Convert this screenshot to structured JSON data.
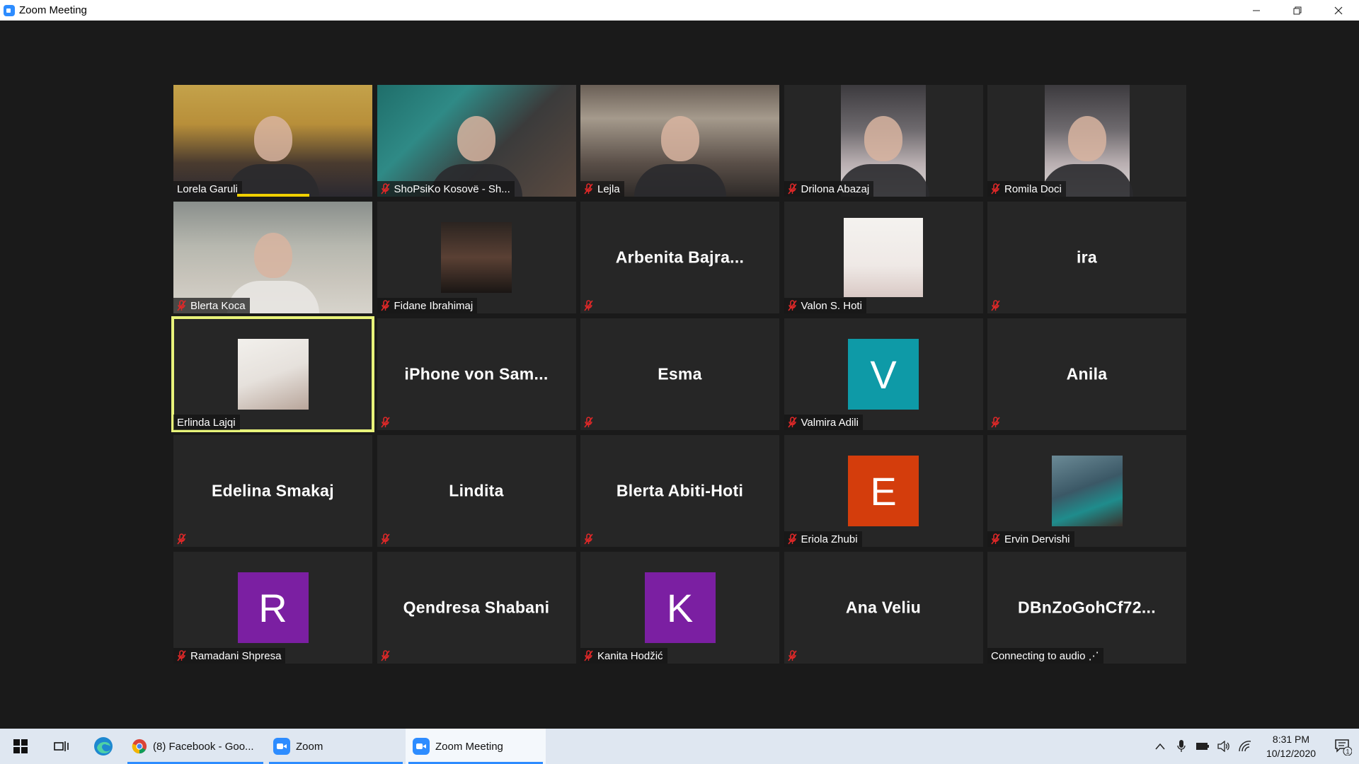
{
  "window": {
    "title": "Zoom Meeting"
  },
  "tiles": [
    {
      "name": "Lorela Garuli",
      "muted": false,
      "kind": "video",
      "speaking": true
    },
    {
      "name": "ShoPsiKo Kosovë - Sh...",
      "muted": true,
      "kind": "video"
    },
    {
      "name": "Lejla",
      "muted": true,
      "kind": "video"
    },
    {
      "name": "Drilona Abazaj",
      "muted": true,
      "kind": "video"
    },
    {
      "name": "Romila Doci",
      "muted": true,
      "kind": "video"
    },
    {
      "name": "Blerta Koca",
      "muted": true,
      "kind": "video"
    },
    {
      "name": "Fidane Ibrahimaj",
      "muted": true,
      "kind": "picture"
    },
    {
      "name": "Arbenita  Bajra...",
      "muted": true,
      "kind": "text"
    },
    {
      "name": "Valon S. Hoti",
      "muted": true,
      "kind": "picture"
    },
    {
      "name": "ira",
      "muted": true,
      "kind": "text"
    },
    {
      "name": "Erlinda Lajqi",
      "muted": false,
      "kind": "picture",
      "active": true
    },
    {
      "name": "iPhone von Sam...",
      "muted": true,
      "kind": "text"
    },
    {
      "name": "Esma",
      "muted": true,
      "kind": "text"
    },
    {
      "name": "Valmira Adili",
      "muted": true,
      "kind": "avatar",
      "letter": "V",
      "color": "#0e9aa7"
    },
    {
      "name": "Anila",
      "muted": true,
      "kind": "text"
    },
    {
      "name": "Edelina Smakaj",
      "muted": true,
      "kind": "text"
    },
    {
      "name": "Lindita",
      "muted": true,
      "kind": "text"
    },
    {
      "name": "Blerta Abiti-Hoti",
      "muted": true,
      "kind": "text"
    },
    {
      "name": "Eriola Zhubi",
      "muted": true,
      "kind": "avatar",
      "letter": "E",
      "color": "#d43d0c"
    },
    {
      "name": "Ervin Dervishi",
      "muted": true,
      "kind": "picture"
    },
    {
      "name": "Ramadani Shpresa",
      "muted": true,
      "kind": "avatar",
      "letter": "R",
      "color": "#7b1fa2"
    },
    {
      "name": "Qendresa Shabani",
      "muted": true,
      "kind": "text"
    },
    {
      "name": "Kanita Hodžić",
      "muted": true,
      "kind": "avatar",
      "letter": "K",
      "color": "#7b1fa2"
    },
    {
      "name": "Ana Veliu",
      "muted": true,
      "kind": "text"
    },
    {
      "name": "DBnZoGohCf72...",
      "muted": false,
      "kind": "text",
      "status": "Connecting to audio"
    }
  ],
  "taskbar": {
    "apps": [
      {
        "label": "(8) Facebook - Goo...",
        "icon": "chrome-icon"
      },
      {
        "label": "Zoom",
        "icon": "zoom-icon"
      },
      {
        "label": "Zoom Meeting",
        "icon": "zoom-icon",
        "active": true
      }
    ],
    "time": "8:31 PM",
    "date": "10/12/2020",
    "notification_count": "1"
  }
}
